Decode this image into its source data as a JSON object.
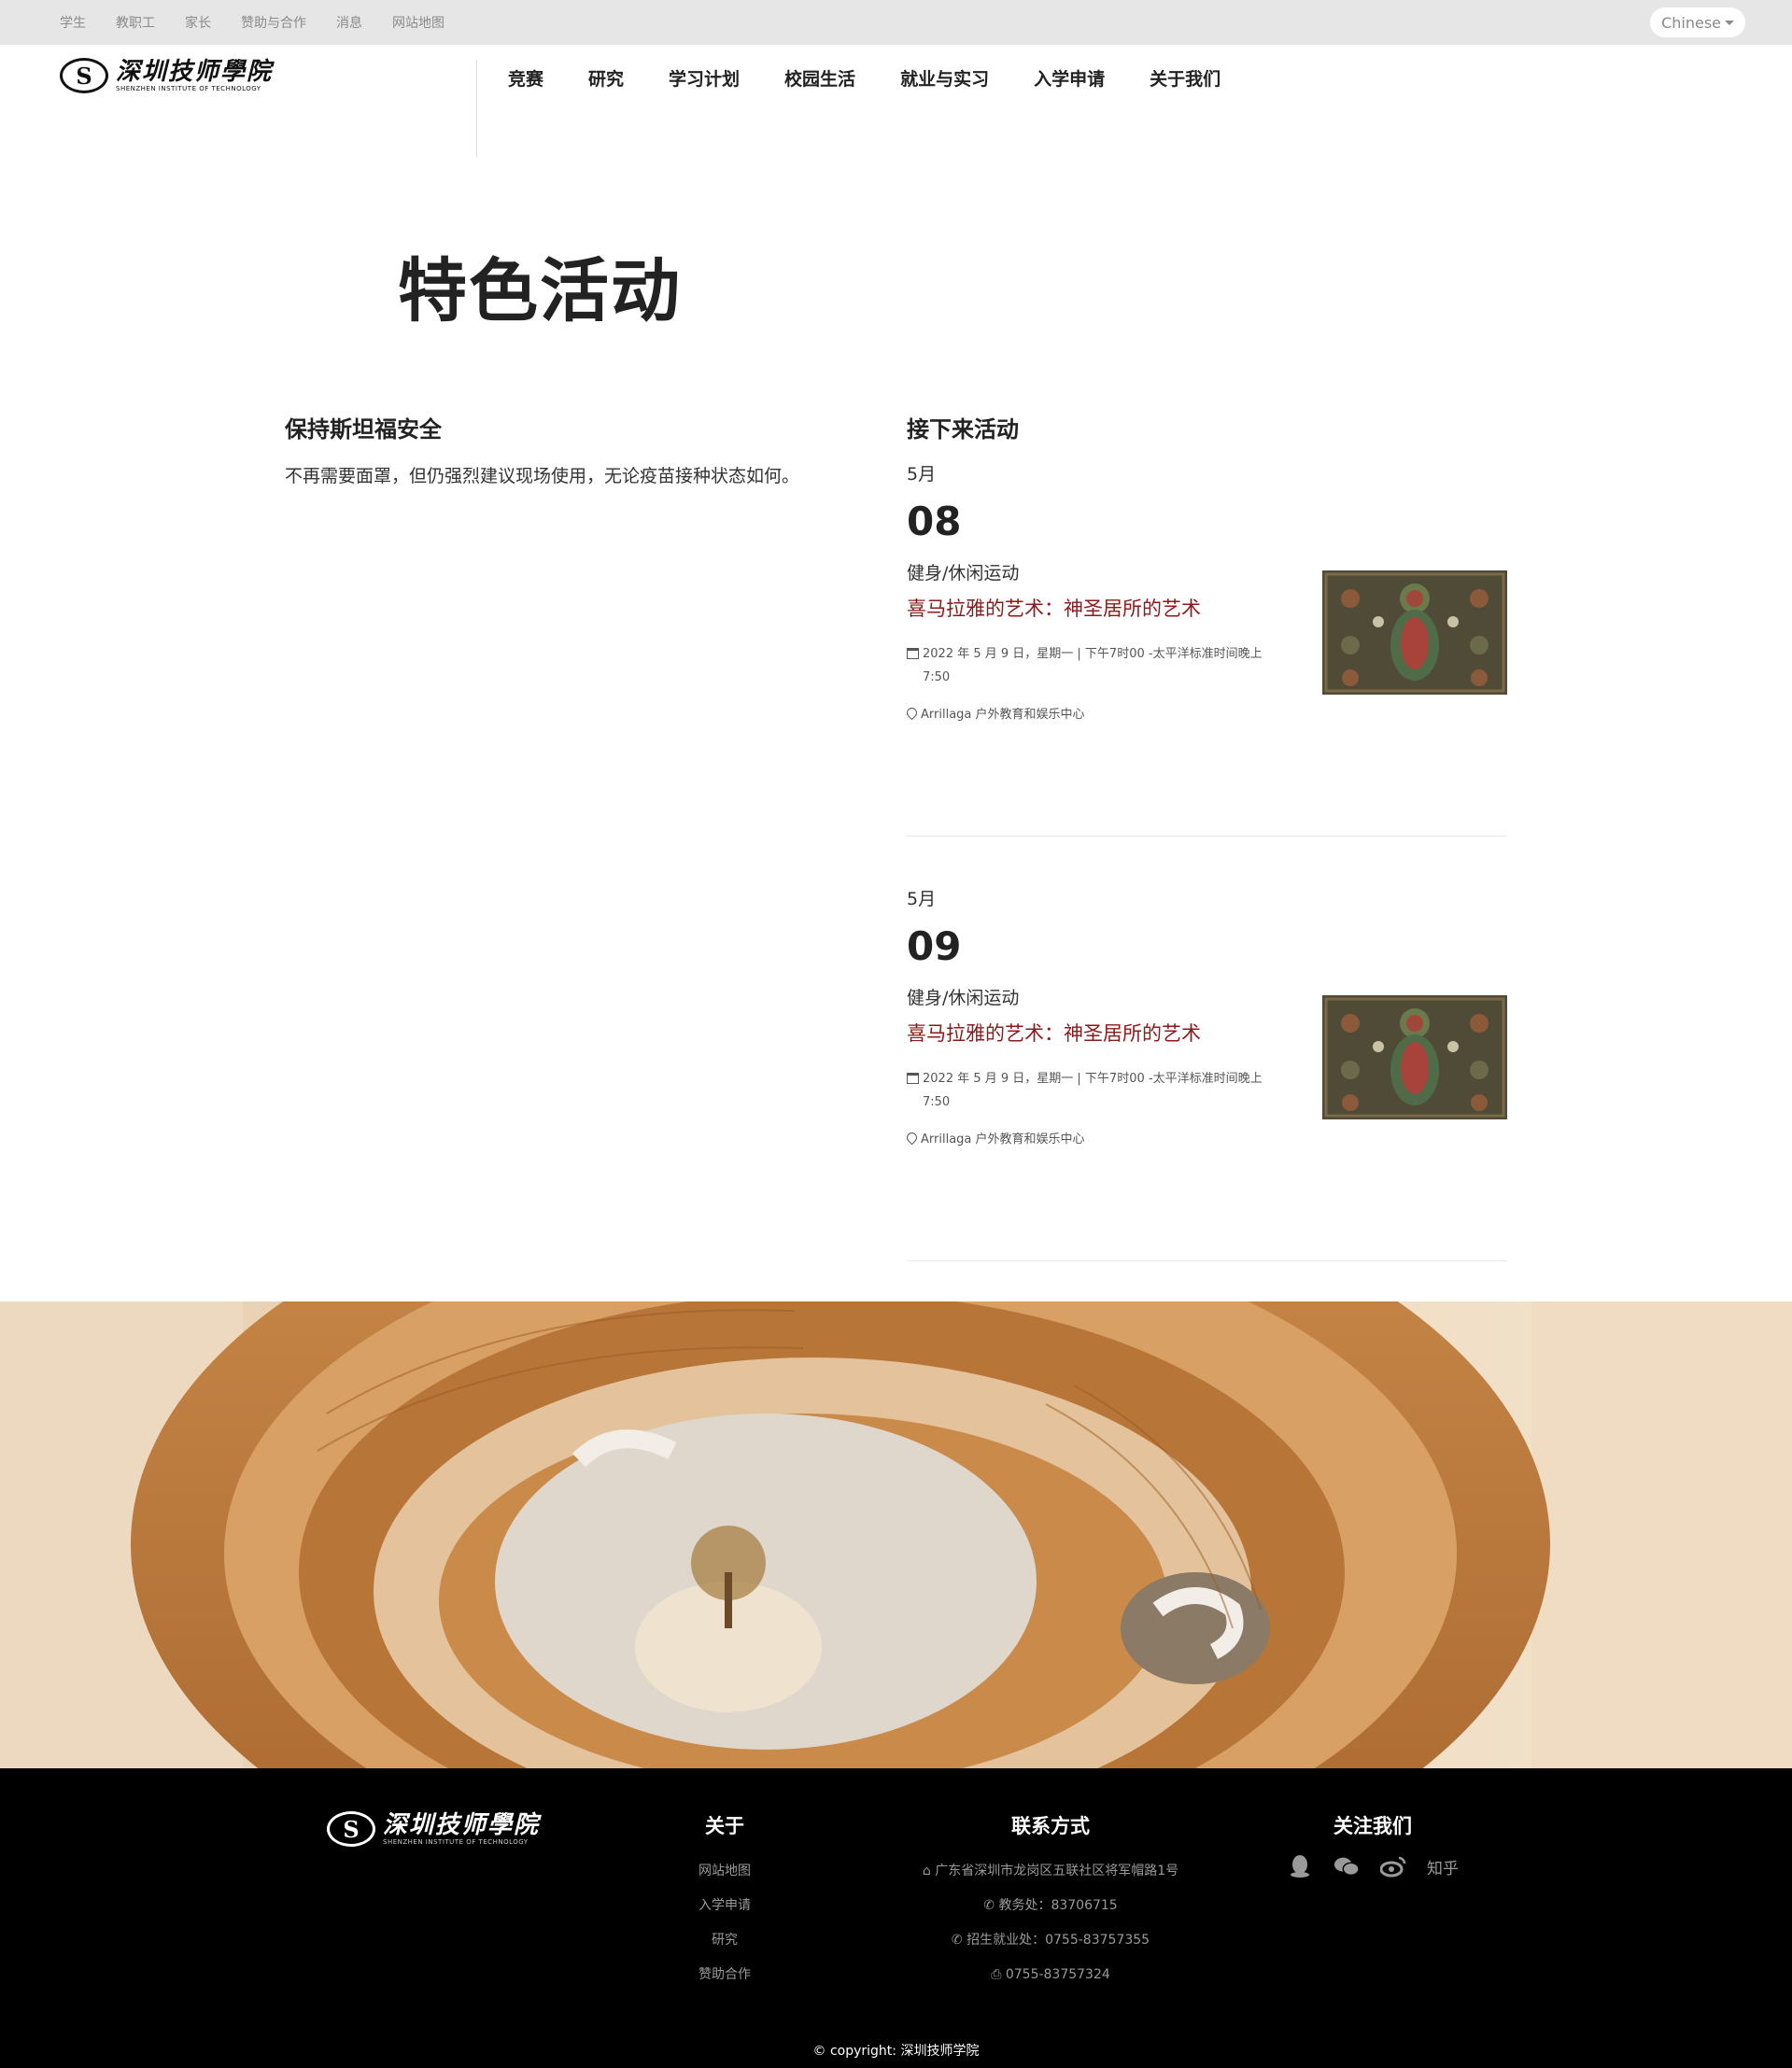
{
  "topbar": {
    "links": [
      "学生",
      "教职工",
      "家长",
      "赞助与合作",
      "消息",
      "网站地图"
    ],
    "language": "Chinese"
  },
  "header": {
    "logo_cn": "深圳技师學院",
    "logo_en": "SHENZHEN INSTITUTE OF TECHNOLOGY",
    "nav": [
      "竞赛",
      "研究",
      "学习计划",
      "校园生活",
      "就业与实习",
      "入学申请",
      "关于我们"
    ]
  },
  "page": {
    "title": "特色活动"
  },
  "safety": {
    "heading": "保持斯坦福安全",
    "text": "不再需要面罩，但仍强烈建议现场使用，无论疫苗接种状态如何。"
  },
  "upcoming": {
    "heading": "接下来活动",
    "events": [
      {
        "month": "5月",
        "day": "08",
        "category": "健身/休闲运动",
        "title": "喜马拉雅的艺术：神圣居所的艺术",
        "datetime": "2022 年 5 月 9 日，星期一 | 下午7时00 -太平洋标准时间晚上 7:50",
        "location": "Arrillaga 户外教育和娱乐中心"
      },
      {
        "month": "5月",
        "day": "09",
        "category": "健身/休闲运动",
        "title": "喜马拉雅的艺术：神圣居所的艺术",
        "datetime": "2022 年 5 月 9 日，星期一 | 下午7时00 -太平洋标准时间晚上 7:50",
        "location": "Arrillaga 户外教育和娱乐中心"
      }
    ]
  },
  "footer": {
    "logo_cn": "深圳技师學院",
    "logo_en": "SHENZHEN INSTITUTE OF TECHNOLOGY",
    "about": {
      "heading": "关于",
      "links": [
        "网站地图",
        "入学申请",
        "研究",
        "赞助合作"
      ]
    },
    "contact": {
      "heading": "联系方式",
      "address": "广东省深圳市龙岗区五联社区将军帽路1号",
      "phone_academic": "教务处：83706715",
      "phone_admissions": "招生就业处：0755-83757355",
      "fax": "0755-83757324"
    },
    "follow": {
      "heading": "关注我们",
      "icons": [
        "qq-icon",
        "wechat-icon",
        "weibo-icon"
      ],
      "zhihu": "知乎"
    },
    "copyright": "© copyright: 深圳技师学院"
  },
  "colors": {
    "accent_title": "#8b1a1a",
    "topbar_bg": "#e6e6e6",
    "footer_bg": "#000000"
  }
}
